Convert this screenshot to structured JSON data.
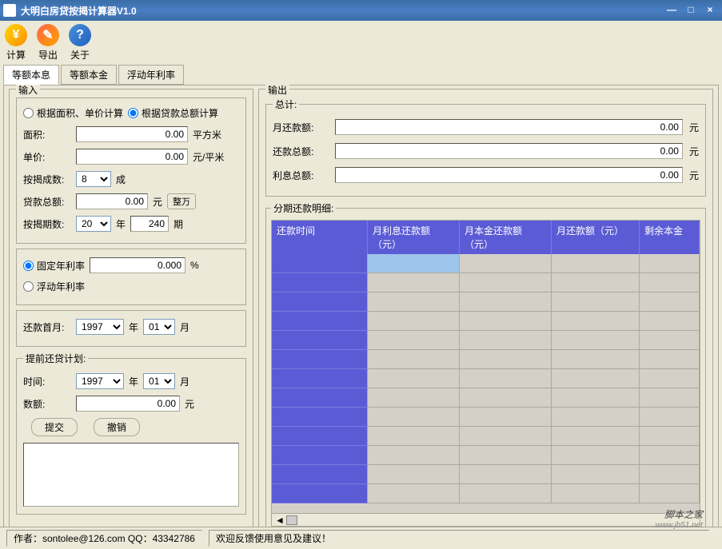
{
  "window": {
    "title": "大明白房贷按揭计算器V1.0"
  },
  "toolbar": {
    "calc": "计算",
    "export": "导出",
    "about": "关于"
  },
  "tabs": [
    "等额本息",
    "等额本金",
    "浮动年利率"
  ],
  "input": {
    "title": "输入",
    "radio_area": "根据面积、单价计算",
    "radio_total": "根据贷款总额计算",
    "area_label": "面积:",
    "area_val": "0.00",
    "area_unit": "平方米",
    "price_label": "单价:",
    "price_val": "0.00",
    "price_unit": "元/平米",
    "ratio_label": "按揭成数:",
    "ratio_val": "8",
    "ratio_unit": "成",
    "loan_label": "贷款总额:",
    "loan_val": "0.00",
    "loan_unit": "元",
    "loan_btn": "整万",
    "periods_label": "按揭期数:",
    "periods_year": "20",
    "periods_year_unit": "年",
    "periods_month": "240",
    "periods_unit": "期",
    "rate_fixed": "固定年利率",
    "rate_val": "0.000",
    "rate_unit": "%",
    "rate_float": "浮动年利率",
    "firstpay_label": "还款首月:",
    "firstpay_year": "1997",
    "firstpay_year_unit": "年",
    "firstpay_month": "01",
    "firstpay_month_unit": "月",
    "prepay_title": "提前还贷计划:",
    "prepay_time_label": "时间:",
    "prepay_year": "1997",
    "prepay_month": "01",
    "prepay_amt_label": "数额:",
    "prepay_amt": "0.00",
    "prepay_unit": "元",
    "submit": "提交",
    "cancel": "撤销"
  },
  "output": {
    "title": "输出",
    "summary_title": "总计:",
    "monthly_label": "月还款额:",
    "monthly_val": "0.00",
    "unit": "元",
    "total_label": "还款总额:",
    "total_val": "0.00",
    "interest_label": "利息总额:",
    "interest_val": "0.00",
    "detail_title": "分期还款明细:",
    "cols": [
      "还款时间",
      "月利息还款额（元）",
      "月本金还款额（元）",
      "月还款额（元）",
      "剩余本金"
    ]
  },
  "status": {
    "author": "作者：sontolee@126.com     QQ：43342786",
    "welcome": "欢迎反馈使用意见及建议！"
  },
  "watermark": {
    "name": "脚本之家",
    "url": "www.jb51.net"
  }
}
